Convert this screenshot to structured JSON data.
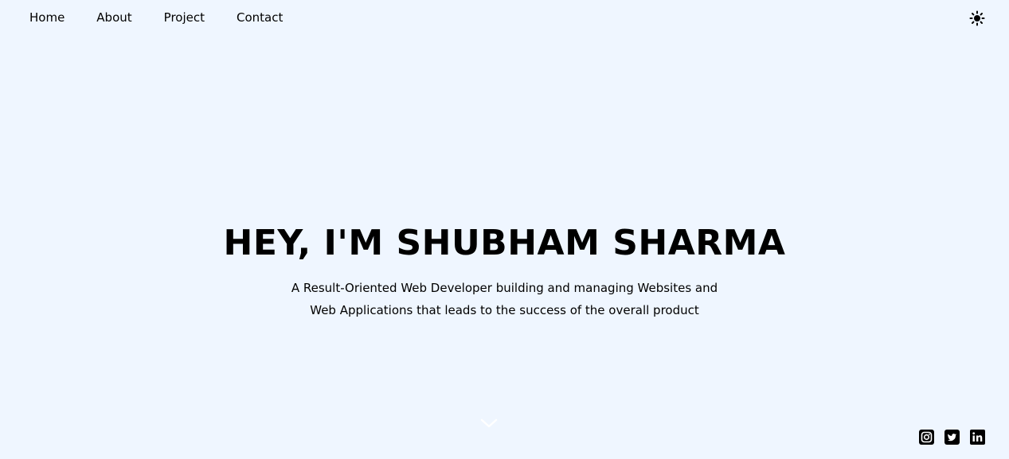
{
  "nav": {
    "items": [
      {
        "label": "Home"
      },
      {
        "label": "About"
      },
      {
        "label": "Project"
      },
      {
        "label": "Contact"
      }
    ]
  },
  "theme_toggle": {
    "icon": "sun-icon"
  },
  "hero": {
    "title": "HEY, I'M SHUBHAM SHARMA",
    "subtitle": "A Result-Oriented Web Developer building and managing Websites and Web Applications that leads to the success of the overall product"
  },
  "scroll_indicator": {
    "icon": "chevron-down-icon"
  },
  "social": {
    "icons": [
      "instagram-icon",
      "twitter-icon",
      "linkedin-icon"
    ]
  },
  "colors": {
    "background": "#eff6ff",
    "text": "#000000"
  }
}
